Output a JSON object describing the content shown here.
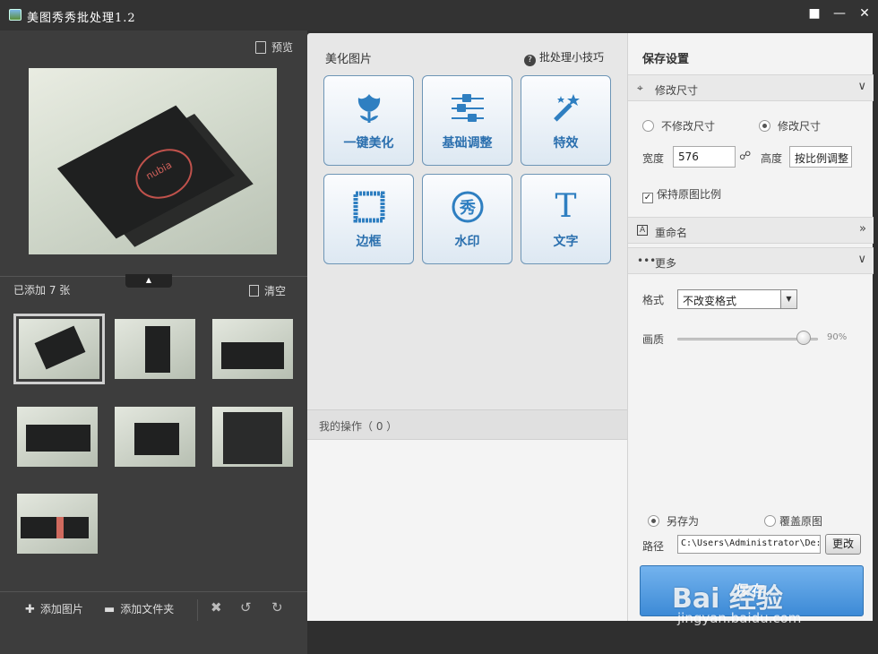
{
  "window": {
    "title": "美图秀秀批处理1.2",
    "controls": [
      "feedback-icon",
      "minimize-icon",
      "maximize-icon",
      "close-icon"
    ]
  },
  "left_panel": {
    "preview_label": "预览",
    "added_label": "已添加 7 张",
    "clear_label": "清空",
    "preview_brand_text": "nubia",
    "thumbnail_count": 7,
    "selected_thumbnail": 1,
    "add_image_label": "添加图片",
    "add_folder_label": "添加文件夹"
  },
  "middle_panel": {
    "title": "美化图片",
    "tips_label": "批处理小技巧",
    "tools": [
      {
        "label": "一键美化",
        "icon": "tulip-icon"
      },
      {
        "label": "基础调整",
        "icon": "sliders-icon"
      },
      {
        "label": "特效",
        "icon": "magic-wand-icon"
      },
      {
        "label": "边框",
        "icon": "frame-icon"
      },
      {
        "label": "水印",
        "icon": "watermark-icon",
        "glyph": "秀"
      },
      {
        "label": "文字",
        "icon": "text-icon",
        "glyph": "T"
      }
    ],
    "operations_label": "我的操作（ 0 ）"
  },
  "right_panel": {
    "title": "保存设置",
    "resize_section": "修改尺寸",
    "no_resize_label": "不修改尺寸",
    "resize_label": "修改尺寸",
    "resize_selected": true,
    "width_label": "宽度",
    "width_value": "576",
    "height_label": "高度",
    "height_value": "按比例调整",
    "keep_ratio_label": "保持原图比例",
    "keep_ratio_checked": true,
    "rename_section": "重命名",
    "more_section": "更多",
    "format_label": "格式",
    "format_value": "不改变格式",
    "quality_label": "画质",
    "quality_value": "90%",
    "quality_fraction": 0.9,
    "save_as_label": "另存为",
    "overwrite_label": "覆盖原图",
    "save_as_selected": true,
    "path_label": "路径",
    "path_value": "C:\\Users\\Administrator\\De:",
    "change_label": "更改",
    "save_label": "保存"
  },
  "watermark": {
    "main": "Bai 经验",
    "sub": "jingyan.baidu.com"
  },
  "colors": {
    "accent": "#2f7fc1",
    "save_button": "#3d8ad6",
    "dark_bg": "#3d3d3d"
  }
}
